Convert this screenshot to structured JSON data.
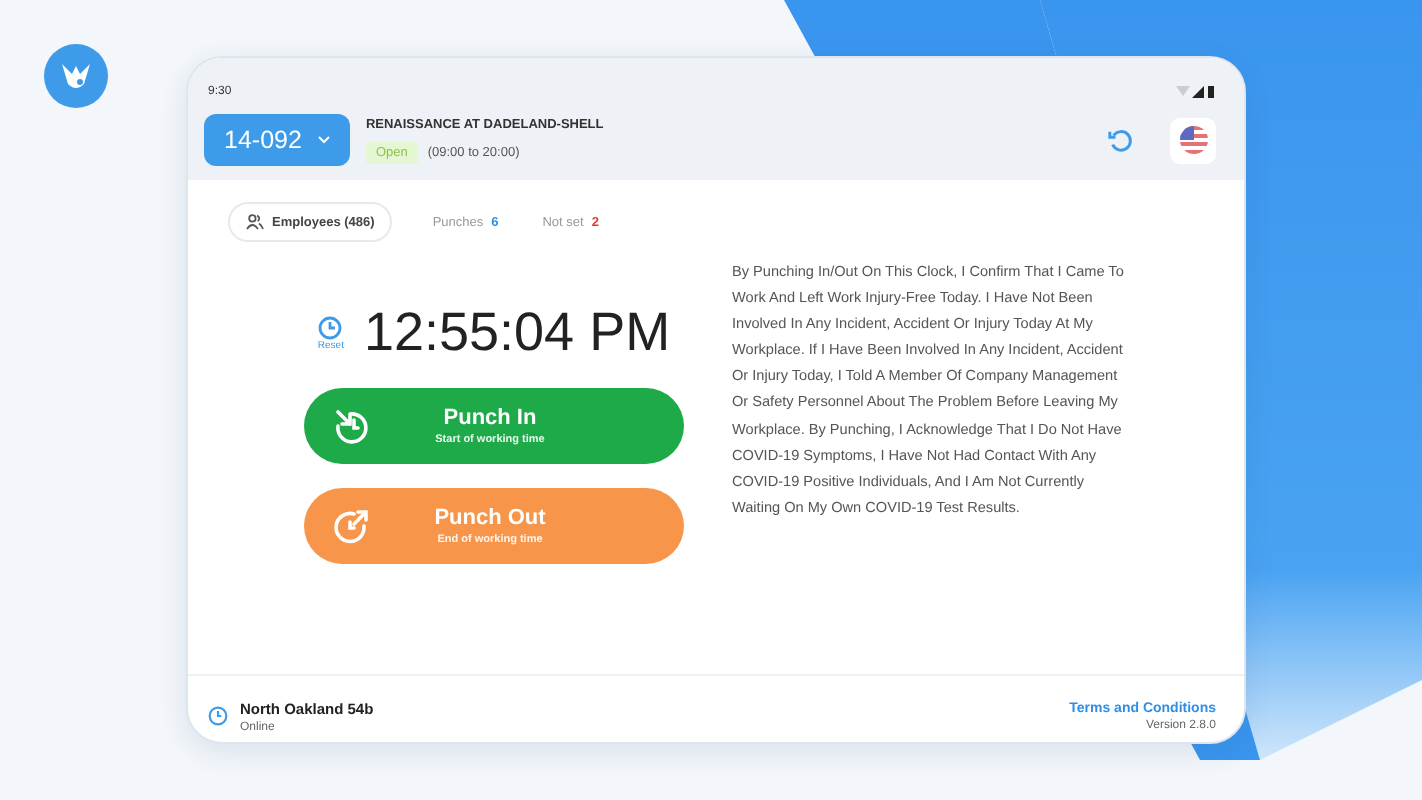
{
  "status_bar": {
    "time": "9:30"
  },
  "header": {
    "store_code": "14-092",
    "store_name": "RENAISSANCE AT DADELAND-SHELL",
    "status": "Open",
    "hours": "(09:00 to 20:00)"
  },
  "tabs": [
    {
      "label": "Employees (486)",
      "selected": true
    },
    {
      "label": "Punches",
      "count": "6",
      "color": "#2f8fe6",
      "selected": false
    },
    {
      "label": "Not set",
      "count": "2",
      "color": "#e53935",
      "selected": false
    }
  ],
  "clock": {
    "reset_label": "Reset",
    "time": "12:55:04 PM"
  },
  "buttons": [
    {
      "kind": "in",
      "label": "Punch In",
      "sublabel": "Start of working time"
    },
    {
      "kind": "out",
      "label": "Punch Out",
      "sublabel": "End of working time"
    }
  ],
  "disclaimer": "By Punching In/Out On This Clock, I Confirm That I Came To Work And Left Work Injury-Free Today. I Have Not Been Involved In Any Incident, Accident Or Injury Today At My Workplace. If I Have Been Involved In Any Incident, Accident Or Injury Today, I Told A Member Of Company Management Or Safety Personnel About The Problem Before Leaving My Workplace. By Punching, I Acknowledge That I Do Not Have COVID-19 Symptoms, I Have Not Had Contact With Any COVID-19 Positive Individuals, And I Am Not Currently Waiting On My Own COVID-19 Test Results.",
  "footer": {
    "location": "North Oakland 54b",
    "status": "Online",
    "terms_link": "Terms and Conditions",
    "version": "Version 2.8.0"
  }
}
